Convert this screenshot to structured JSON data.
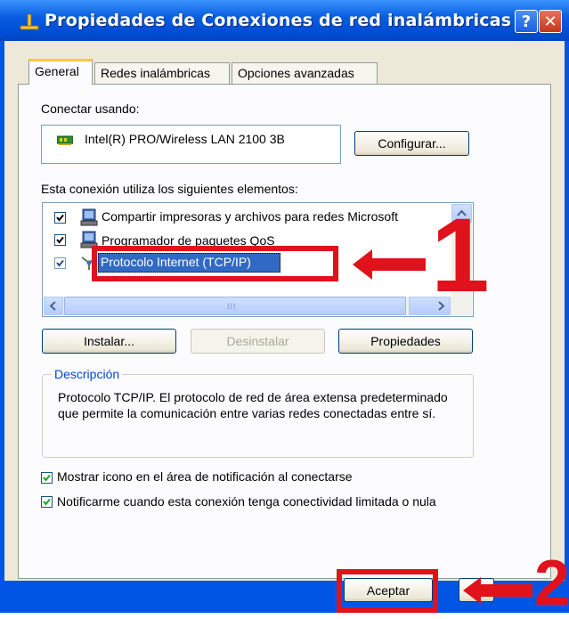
{
  "window": {
    "title": "Propiedades de Conexiones de red inalámbricas",
    "help_label": "?",
    "close_label": "✕"
  },
  "tabs": [
    {
      "label": "General",
      "active": true
    },
    {
      "label": "Redes inalámbricas",
      "active": false
    },
    {
      "label": "Opciones avanzadas",
      "active": false
    }
  ],
  "general": {
    "connect_using_label": "Conectar usando:",
    "adapter_name": "Intel(R) PRO/Wireless LAN 2100 3B",
    "configure_label": "Configurar...",
    "uses_label": "Esta conexión utiliza los siguientes elementos:",
    "items": [
      {
        "label": "Compartir impresoras y archivos para redes Microsoft",
        "checked": true,
        "icon": "network-printer-icon"
      },
      {
        "label": "Programador de paquetes QoS",
        "checked": true,
        "icon": "network-service-icon"
      },
      {
        "label": "Protocolo Internet (TCP/IP)",
        "checked": true,
        "selected": true,
        "icon": "protocol-icon"
      }
    ],
    "scroll_grip": "III",
    "install_label": "Instalar...",
    "uninstall_label": "Desinstalar",
    "properties_label": "Propiedades",
    "description_title": "Descripción",
    "description_text": "Protocolo TCP/IP. El protocolo de red de área extensa predeterminado que permite la comunicación entre varias redes conectadas entre sí.",
    "notify_label": "Mostrar icono en el área de notificación al conectarse",
    "notify_checked": true,
    "limited_label": "Notificarme cuando esta conexión tenga conectividad limitada o nula",
    "limited_checked": true
  },
  "footer": {
    "ok_label": "Aceptar",
    "cancel_label": ""
  },
  "annotations": {
    "step1": "1",
    "step2": "2",
    "color": "#e0121b"
  }
}
